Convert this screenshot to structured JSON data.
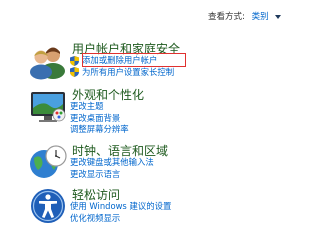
{
  "header": {
    "view_by_label": "查看方式:",
    "view_by_value": "类别"
  },
  "sections": [
    {
      "title": "用户帐户和家庭安全",
      "icon": "users-icon",
      "links": [
        {
          "label": "添加或删除用户帐户",
          "shield": true
        },
        {
          "label": "为所有用户设置家长控制",
          "shield": true
        }
      ]
    },
    {
      "title": "外观和个性化",
      "icon": "appearance-icon",
      "links": [
        {
          "label": "更改主题",
          "shield": false
        },
        {
          "label": "更改桌面背景",
          "shield": false
        },
        {
          "label": "调整屏幕分辨率",
          "shield": false
        }
      ]
    },
    {
      "title": "时钟、语言和区域",
      "icon": "clock-globe-icon",
      "links": [
        {
          "label": "更改键盘或其他输入法",
          "shield": false
        },
        {
          "label": "更改显示语言",
          "shield": false
        }
      ]
    },
    {
      "title": "轻松访问",
      "icon": "ease-of-access-icon",
      "links": [
        {
          "label": "使用 Windows 建议的设置",
          "shield": false
        },
        {
          "label": "优化视频显示",
          "shield": false
        }
      ]
    }
  ],
  "colors": {
    "title": "#1e5a1e",
    "link": "#0066cc",
    "highlight": "#e0312f"
  }
}
